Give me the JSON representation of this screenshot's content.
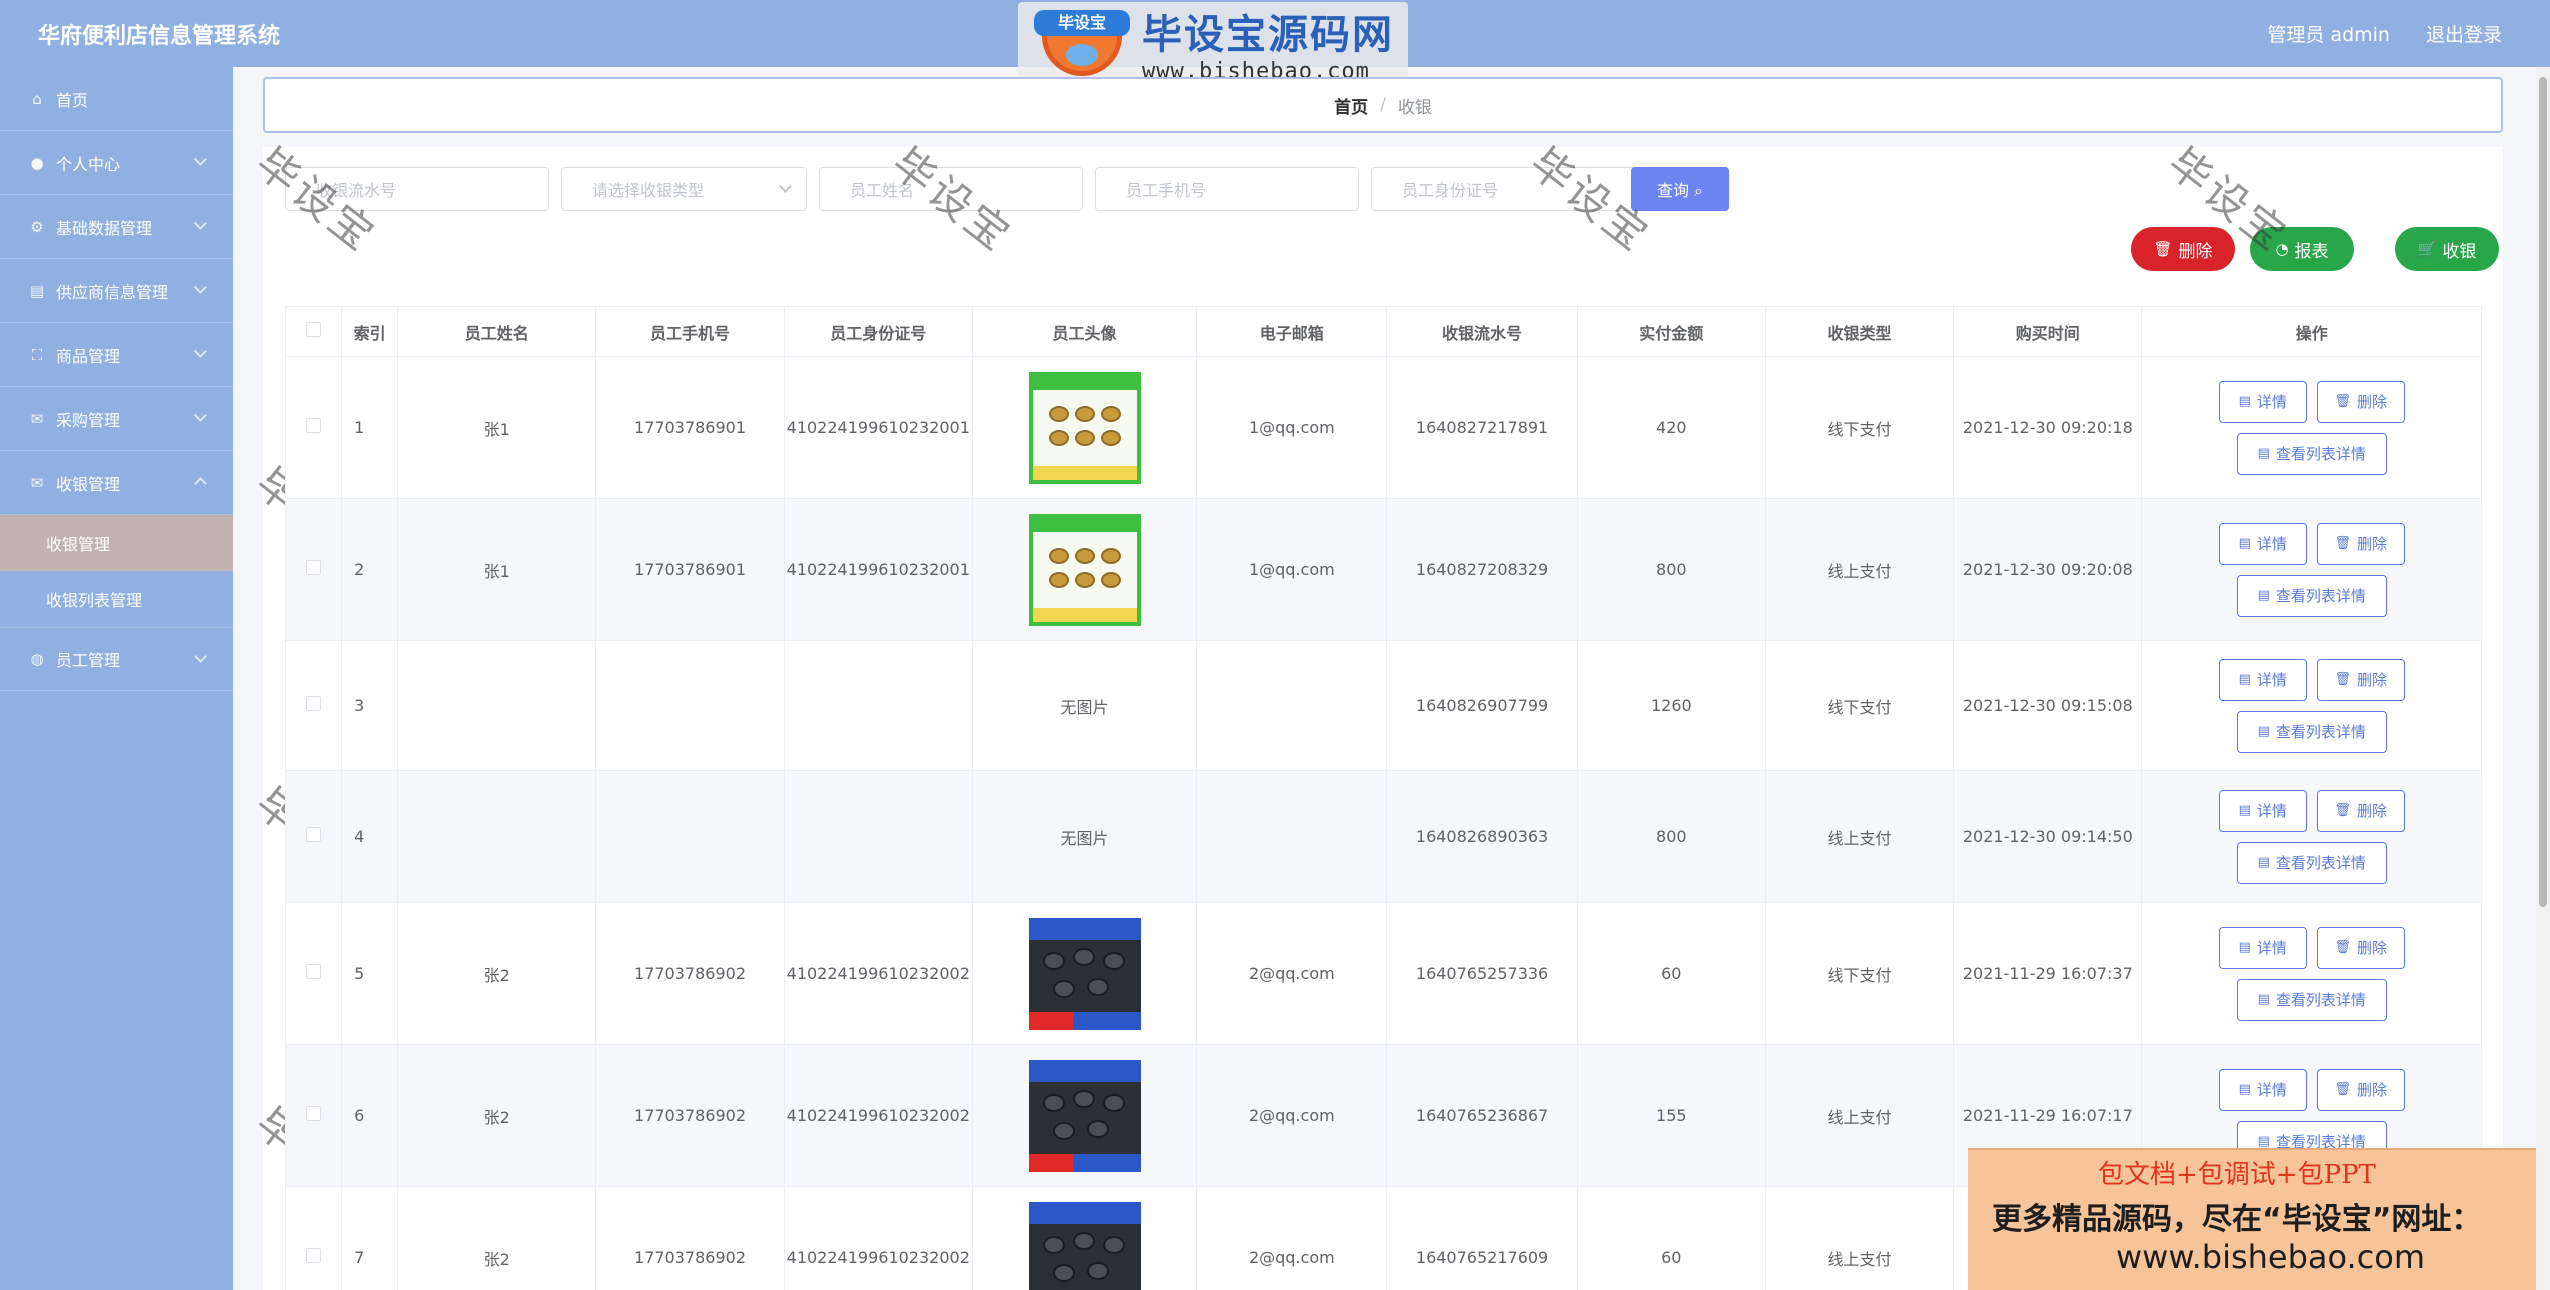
{
  "header": {
    "app_title": "华府便利店信息管理系统",
    "user_label": "管理员 admin",
    "logout_label": "退出登录"
  },
  "logo": {
    "badge": "毕设宝",
    "title": "毕设宝源码网",
    "url": "www.bishebao.com"
  },
  "sidebar": {
    "items": [
      {
        "label": "首页",
        "icon": "home-icon"
      },
      {
        "label": "个人中心",
        "icon": "user-icon"
      },
      {
        "label": "基础数据管理",
        "icon": "settings-icon"
      },
      {
        "label": "供应商信息管理",
        "icon": "document-icon"
      },
      {
        "label": "商品管理",
        "icon": "frame-icon"
      },
      {
        "label": "采购管理",
        "icon": "mail-icon"
      },
      {
        "label": "收银管理",
        "icon": "mail-icon"
      }
    ],
    "sub_items": [
      "收银管理",
      "收银列表管理"
    ],
    "last_item": {
      "label": "员工管理",
      "icon": "globe-icon"
    }
  },
  "breadcrumb": {
    "home": "首页",
    "sep": "/",
    "current": "收银"
  },
  "search": {
    "serial_placeholder": "收银流水号",
    "type_placeholder": "请选择收银类型",
    "name_placeholder": "员工姓名",
    "phone_placeholder": "员工手机号",
    "idcard_placeholder": "员工身份证号",
    "query_label": "查询 ⌕"
  },
  "actions": {
    "delete_label": "删除",
    "report_label": "报表",
    "cashier_label": "收银"
  },
  "table": {
    "headers": [
      "索引",
      "员工姓名",
      "员工手机号",
      "员工身份证号",
      "员工头像",
      "电子邮箱",
      "收银流水号",
      "实付金额",
      "收银类型",
      "购买时间",
      "操作"
    ],
    "no_image": "无图片",
    "op_detail": "详情",
    "op_delete": "删除",
    "op_list": "查看列表详情",
    "rows": [
      {
        "idx": "1",
        "name": "张1",
        "phone": "17703786901",
        "idcard": "410224199610232001",
        "img": "green",
        "email": "1@qq.com",
        "serial": "1640827217891",
        "amount": "420",
        "type": "线下支付",
        "time": "2021-12-30 09:20:18"
      },
      {
        "idx": "2",
        "name": "张1",
        "phone": "17703786901",
        "idcard": "410224199610232001",
        "img": "green",
        "email": "1@qq.com",
        "serial": "1640827208329",
        "amount": "800",
        "type": "线上支付",
        "time": "2021-12-30 09:20:08"
      },
      {
        "idx": "3",
        "name": "",
        "phone": "",
        "idcard": "",
        "img": "none",
        "email": "",
        "serial": "1640826907799",
        "amount": "1260",
        "type": "线下支付",
        "time": "2021-12-30 09:15:08"
      },
      {
        "idx": "4",
        "name": "",
        "phone": "",
        "idcard": "",
        "img": "none",
        "email": "",
        "serial": "1640826890363",
        "amount": "800",
        "type": "线上支付",
        "time": "2021-12-30 09:14:50"
      },
      {
        "idx": "5",
        "name": "张2",
        "phone": "17703786902",
        "idcard": "410224199610232002",
        "img": "dark",
        "email": "2@qq.com",
        "serial": "1640765257336",
        "amount": "60",
        "type": "线下支付",
        "time": "2021-11-29 16:07:37"
      },
      {
        "idx": "6",
        "name": "张2",
        "phone": "17703786902",
        "idcard": "410224199610232002",
        "img": "dark",
        "email": "2@qq.com",
        "serial": "1640765236867",
        "amount": "155",
        "type": "线上支付",
        "time": "2021-11-29 16:07:17"
      },
      {
        "idx": "7",
        "name": "张2",
        "phone": "17703786902",
        "idcard": "410224199610232002",
        "img": "dark",
        "email": "2@qq.com",
        "serial": "1640765217609",
        "amount": "60",
        "type": "线上支付",
        "time": ""
      }
    ]
  },
  "watermark_text": "毕设宝",
  "banner": {
    "line1": "包文档+包调试+包PPT",
    "line2": "更多精品源码，尽在“毕设宝”网址：",
    "line3": "www.bishebao.com"
  }
}
